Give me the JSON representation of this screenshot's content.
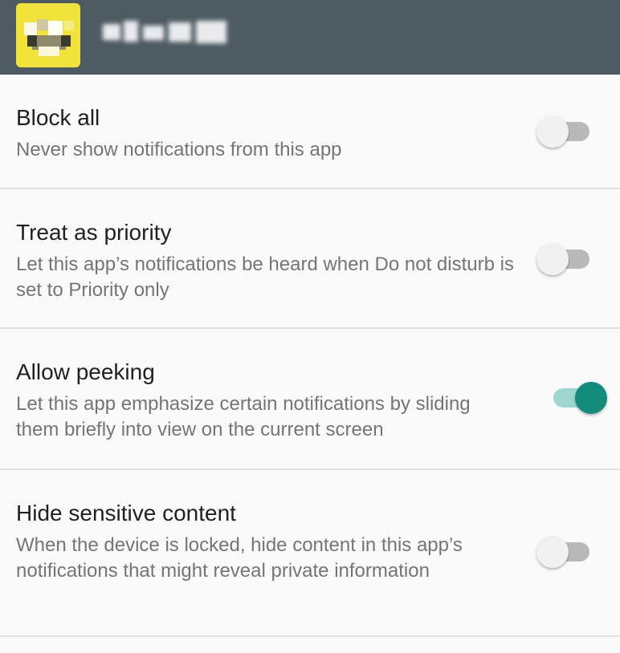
{
  "app_header": {
    "icon": "app-icon",
    "title": "",
    "bg": "#4f5b62",
    "icon_bg": "#f2e33a"
  },
  "settings": [
    {
      "id": "block-all",
      "title": "Block all",
      "subtitle": "Never show notifications from this app",
      "enabled": false
    },
    {
      "id": "treat-as-priority",
      "title": "Treat as priority",
      "subtitle": "Let this app’s notifications be heard when Do not disturb is set to Priority only",
      "enabled": false
    },
    {
      "id": "allow-peeking",
      "title": "Allow peeking",
      "subtitle": "Let this app emphasize certain notifications by sliding them briefly into view on the current screen",
      "enabled": true
    },
    {
      "id": "hide-sensitive-content",
      "title": "Hide sensitive content",
      "subtitle": "When the device is locked, hide content in this app’s notifications that might reveal private information",
      "enabled": false
    }
  ],
  "colors": {
    "accent": "#138c7d",
    "accent_track": "#9ed7cf",
    "switch_off_thumb": "#f1f1f1",
    "switch_off_track": "#b9b9b9",
    "divider": "#e1e1e1",
    "title_text": "#212121",
    "subtitle_text": "#757575",
    "background": "#fafafa"
  }
}
